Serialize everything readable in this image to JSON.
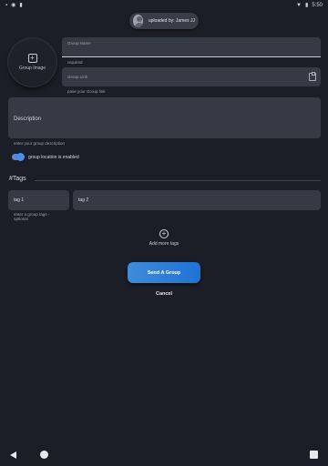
{
  "status_bar": {
    "time": "5:50",
    "left_icons": [
      "notification-icon",
      "data-saver-icon",
      "sim-icon"
    ],
    "right_icons": [
      "wifi-icon",
      "battery-icon"
    ]
  },
  "uploader": {
    "text": "uploaded by: James JJ"
  },
  "group_image": {
    "label": "Group Image"
  },
  "form": {
    "group_name": {
      "label": "Group Name",
      "value": "",
      "helper": "required"
    },
    "group_link": {
      "label": "Group Link",
      "value": "",
      "helper": "pase your Group link"
    },
    "description": {
      "label": "Description",
      "value": "",
      "helper": "enter your group description"
    },
    "location_toggle": {
      "label": "group location is enabled",
      "on": true
    }
  },
  "tags": {
    "title": "#Tags",
    "items": [
      "tag 1",
      "tag 2"
    ],
    "helper": "enter a group tags - optional",
    "add_more_label": "Add more tags"
  },
  "actions": {
    "send_label": "Send A Group",
    "cancel_label": "Cancel"
  },
  "colors": {
    "background": "#1b1e27",
    "field": "#363a45",
    "accent": "#1e72d6"
  }
}
